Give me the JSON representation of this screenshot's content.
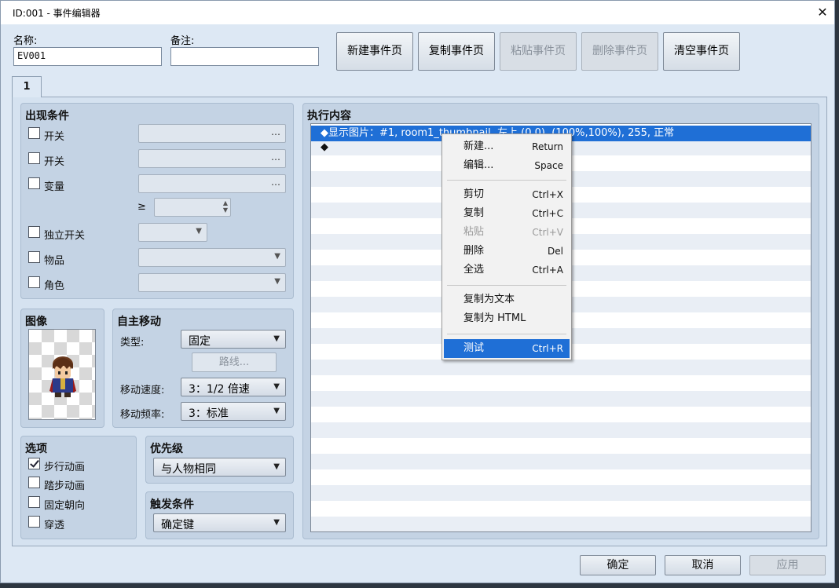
{
  "window": {
    "title": "ID:001 - 事件编辑器",
    "close": "✕"
  },
  "name_field": {
    "label": "名称:",
    "value": "EV001"
  },
  "note_field": {
    "label": "备注:",
    "value": ""
  },
  "page_buttons": {
    "new": "新建事件页",
    "copy": "复制事件页",
    "paste": "粘贴事件页",
    "delete": "删除事件页",
    "clear": "清空事件页"
  },
  "tab": {
    "label": "1"
  },
  "conditions": {
    "title": "出现条件",
    "switch1": "开关",
    "switch2": "开关",
    "variable": "变量",
    "gte": "≥",
    "self_switch": "独立开关",
    "item": "物品",
    "actor": "角色",
    "dots": "…"
  },
  "image": {
    "title": "图像"
  },
  "movement": {
    "title": "自主移动",
    "type_label": "类型:",
    "type_value": "固定",
    "route_button": "路线...",
    "speed_label": "移动速度:",
    "speed_value": "3：1/2 倍速",
    "freq_label": "移动频率:",
    "freq_value": "3：标准"
  },
  "options": {
    "title": "选项",
    "walking": "步行动画",
    "stepping": "踏步动画",
    "direction_fix": "固定朝向",
    "through": "穿透"
  },
  "priority": {
    "title": "优先级",
    "value": "与人物相同"
  },
  "trigger": {
    "title": "触发条件",
    "value": "确定键"
  },
  "contents": {
    "title": "执行内容",
    "rows": [
      "◆显示图片：#1, room1_thumbnail, 左上 (0,0), (100%,100%), 255, 正常",
      "◆"
    ]
  },
  "context_menu": {
    "new": {
      "label": "新建...",
      "key": "Return"
    },
    "edit": {
      "label": "编辑...",
      "key": "Space"
    },
    "cut": {
      "label": "剪切",
      "key": "Ctrl+X"
    },
    "copy": {
      "label": "复制",
      "key": "Ctrl+C"
    },
    "paste": {
      "label": "粘贴",
      "key": "Ctrl+V"
    },
    "delete": {
      "label": "删除",
      "key": "Del"
    },
    "select_all": {
      "label": "全选",
      "key": "Ctrl+A"
    },
    "copy_text": {
      "label": "复制为文本"
    },
    "copy_html": {
      "label": "复制为 HTML"
    },
    "test": {
      "label": "测试",
      "key": "Ctrl+R"
    }
  },
  "footer": {
    "ok": "确定",
    "cancel": "取消",
    "apply": "应用"
  },
  "colors": {
    "selection": "#1f6fd6",
    "window_bg": "#dde8f4",
    "group_bg": "#c4d3e4"
  }
}
